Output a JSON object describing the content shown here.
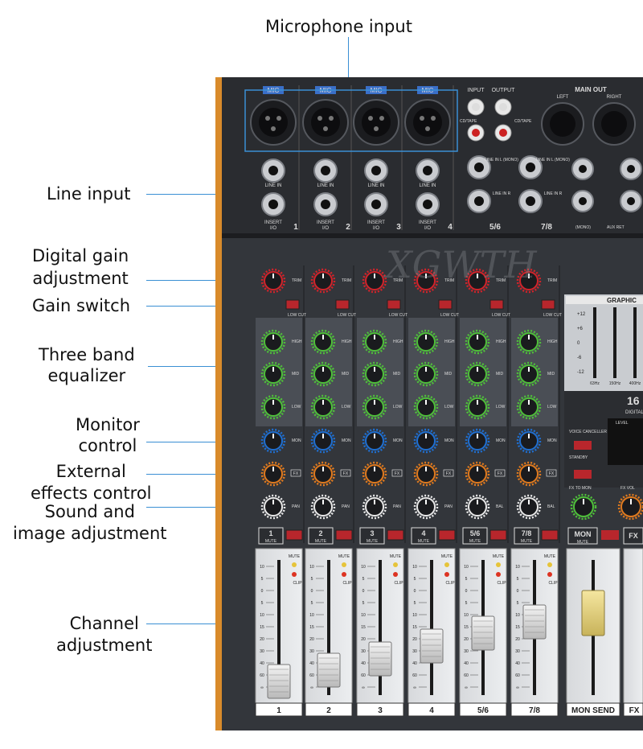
{
  "callouts": {
    "microphone_input": "Microphone input",
    "line_input": "Line input",
    "digital_gain_1": "Digital gain",
    "digital_gain_2": "adjustment",
    "gain_switch": "Gain switch",
    "equalizer_1": "Three band",
    "equalizer_2": "equalizer",
    "monitor_1": "Monitor",
    "monitor_2": "control",
    "effects_1": "External",
    "effects_2": "effects control",
    "sound_image_1": "Sound and",
    "sound_image_2": "image adjustment",
    "channel_1": "Channel",
    "channel_2": "adjustment"
  },
  "panel": {
    "mic_label": "MIC",
    "line_in": "LINE IN",
    "insert": "INSERT",
    "io": "I/O",
    "input_label": "INPUT",
    "output_label": "OUTPUT",
    "cd_tape": "CD/TAPE",
    "main_out": "MAIN OUT",
    "left": "LEFT",
    "right": "RIGHT",
    "line_in_mono": "LINE IN L (MONO)",
    "line_in_r": "LINE IN R",
    "mono": "(MONO)",
    "aux_ret": "AUX RET",
    "trim": "TRIM",
    "low_cut": "LOW CUT",
    "high": "HIGH",
    "mid": "MID",
    "low": "LOW",
    "mon": "MON",
    "fx": "FX",
    "pan": "PAN",
    "bal": "BAL",
    "mute": "MUTE",
    "clip": "CLIP",
    "graphic": "GRAPHIC",
    "brand": "XGWTH",
    "model": "16",
    "digital": "DIGITAL",
    "voice_canceller": "VOICE CANCELLER",
    "standby": "STANDBY",
    "level": "LEVEL",
    "fx_to_mon": "FX TO MON",
    "fx_vol": "FX VOL",
    "mon_send": "MON SEND",
    "fx_short": "FX",
    "mon_label": "MON",
    "eq_freqs": [
      "63Hz",
      "150Hz",
      "400Hz"
    ],
    "eq_scale": [
      "+12",
      "+6",
      "0",
      "-6",
      "-12"
    ],
    "fader_scale": [
      "10",
      "5",
      "0",
      "5",
      "10",
      "15",
      "20",
      "30",
      "40",
      "60",
      "∞"
    ]
  },
  "mic_channels": [
    "1",
    "2",
    "3",
    "4"
  ],
  "stereo_channels": [
    "5/6",
    "7/8"
  ],
  "strip_labels": [
    "1",
    "2",
    "3",
    "4",
    "5/6",
    "7/8"
  ],
  "colors": {
    "trim_knob": "#d2232a",
    "eq_knob": "#4fbf3a",
    "mon_knob": "#1f6fd1",
    "fx_knob": "#e07a1e",
    "pan_knob": "#e8e8e8",
    "mute_button": "#b8262c",
    "panel": "#2b2d31",
    "accent_leader": "#3a8fd4"
  }
}
